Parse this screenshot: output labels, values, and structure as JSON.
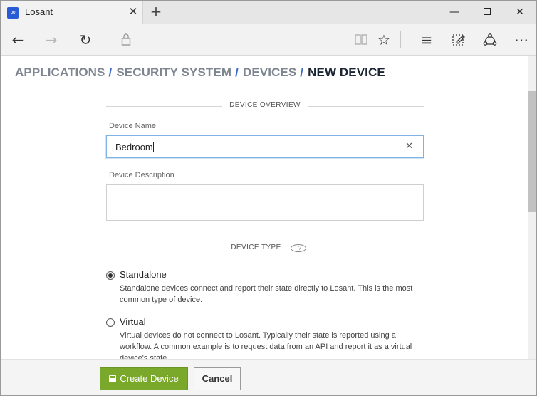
{
  "browser": {
    "tab_title": "Losant",
    "favicon_glyph": "∞",
    "tab_close_glyph": "✕",
    "new_tab_glyph": "+",
    "min_glyph": "—",
    "close_glyph": "✕",
    "back_glyph": "←",
    "forward_glyph": "→",
    "refresh_glyph": "↻",
    "star_glyph": "☆",
    "more_glyph": "⋯",
    "hub_glyph": "≡"
  },
  "breadcrumb": {
    "items": [
      "APPLICATIONS",
      "SECURITY SYSTEM",
      "DEVICES"
    ],
    "separator": "/",
    "current": "NEW DEVICE"
  },
  "form": {
    "overview_header": "DEVICE OVERVIEW",
    "name_label": "Device Name",
    "name_value": "Bedroom",
    "clear_glyph": "✕",
    "description_label": "Device Description",
    "description_value": "",
    "type_header": "DEVICE TYPE",
    "help_glyph": "?",
    "types": [
      {
        "label": "Standalone",
        "description": "Standalone devices connect and report their state directly to Losant. This is the most common type of device.",
        "checked": true
      },
      {
        "label": "Virtual",
        "description": "Virtual devices do not connect to Losant. Typically their state is reported using a workflow. A common example is to request data from an API and report it as a virtual device's state.",
        "checked": false
      }
    ]
  },
  "footer": {
    "create_label": "Create Device",
    "cancel_label": "Cancel"
  },
  "colors": {
    "accent_blue": "#3c6bc4",
    "create_green": "#7aa82a",
    "focus_border": "#7fb3e6"
  }
}
